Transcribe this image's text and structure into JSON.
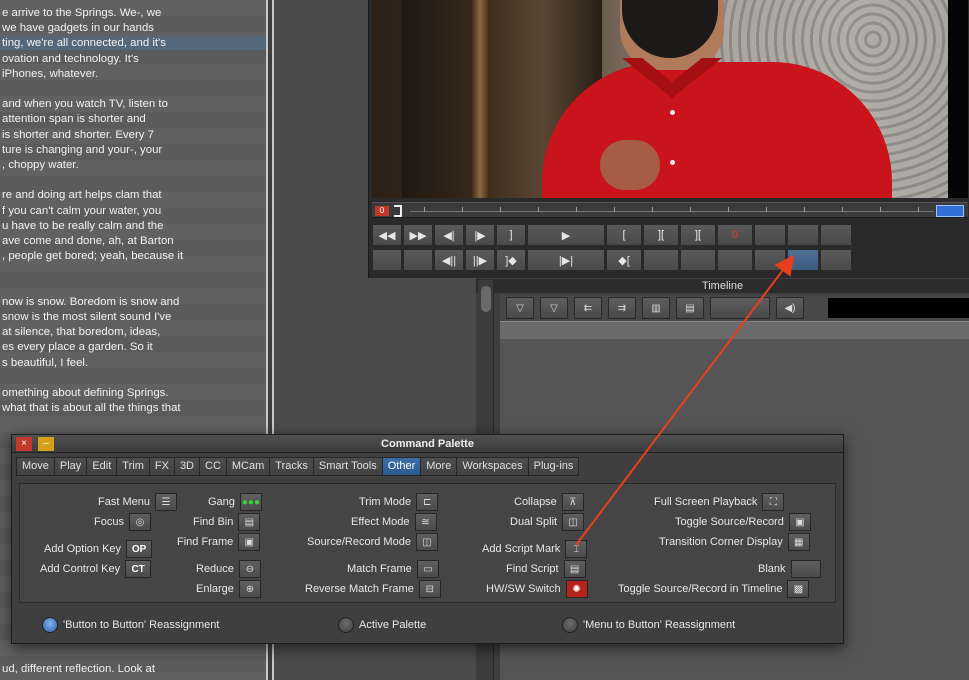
{
  "script": {
    "lines": [
      "e arrive to the Springs.  We-, we",
      " we have gadgets in our hands",
      "ting, we're all connected, and it's",
      "ovation and technology.  It's",
      " iPhones, whatever.",
      "",
      "and when you watch TV, listen to",
      " attention span is shorter and",
      " is shorter and shorter.  Every 7",
      "ture is changing and your-, your",
      ", choppy water.",
      "",
      "re and doing art helps clam that",
      "f you can't calm your water, you",
      "u have to be really calm and the",
      "ave come and done, ah, at Barton",
      ", people get bored; yeah, because it",
      "",
      "",
      "now is snow.  Boredom is snow and",
      " snow is the most silent sound I've",
      "at silence, that boredom, ideas,",
      "es every place a garden.  So it",
      "s beautiful, I feel.",
      "",
      "omething about defining Springs.",
      "what that is about all the things that"
    ],
    "bottom_line": "ud, different reflection.  Look at"
  },
  "monitor": {
    "row1": [
      "◀◀",
      "▶▶",
      "◀|",
      "|▶",
      "]",
      "▶",
      "[",
      "][",
      "][",
      "0",
      "",
      "",
      ""
    ],
    "row2": [
      "",
      "",
      "◀||",
      "||▶",
      "]◆",
      "|▶|",
      "◆[",
      "",
      "",
      "",
      "",
      "",
      ""
    ],
    "timecode_marker": "0"
  },
  "timeline": {
    "title": "Timeline"
  },
  "palette": {
    "title": "Command Palette",
    "tabs": [
      "Move",
      "Play",
      "Edit",
      "Trim",
      "FX",
      "3D",
      "CC",
      "MCam",
      "Tracks",
      "Smart Tools",
      "Other",
      "More",
      "Workspaces",
      "Plug-ins"
    ],
    "active_tab": "Other",
    "commands": {
      "fast_menu": "Fast Menu",
      "focus": "Focus",
      "add_option_key": "Add Option Key",
      "add_option_key_icon": "OP",
      "add_control_key": "Add Control Key",
      "add_control_key_icon": "CT",
      "gang": "Gang",
      "find_bin": "Find Bin",
      "find_frame": "Find Frame",
      "reduce": "Reduce",
      "enlarge": "Enlarge",
      "trim_mode": "Trim Mode",
      "effect_mode": "Effect Mode",
      "source_record_mode": "Source/Record Mode",
      "match_frame": "Match Frame",
      "reverse_match_frame": "Reverse Match Frame",
      "collapse": "Collapse",
      "dual_split": "Dual Split",
      "add_script_mark": "Add Script Mark",
      "find_script": "Find Script",
      "hw_sw_switch": "HW/SW Switch",
      "full_screen_playback": "Full Screen Playback",
      "toggle_source_record": "Toggle Source/Record",
      "transition_corner_display": "Transition Corner Display",
      "blank": "Blank",
      "toggle_source_record_timeline": "Toggle Source/Record in Timeline"
    },
    "modes": {
      "button_to_button": "'Button to Button' Reassignment",
      "active_palette": "Active Palette",
      "menu_to_button": "'Menu to Button' Reassignment",
      "selected": "'Button to Button' Reassignment"
    }
  },
  "colors": {
    "accent": "#2f6fd6",
    "arrow": "#e8401c",
    "close": "#c0392b",
    "minimize": "#d4a017"
  }
}
